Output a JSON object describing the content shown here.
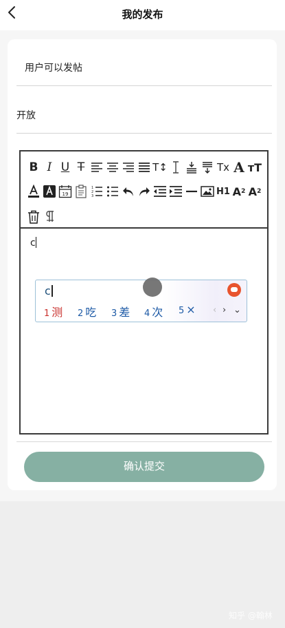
{
  "header": {
    "title": "我的发布",
    "back_icon": "chevron-left-icon"
  },
  "form": {
    "permission_label": "用户可以发帖",
    "visibility_value": "开放"
  },
  "editor": {
    "toolbar_row1": [
      "B",
      "I",
      "U",
      "S",
      "align-left",
      "align-center",
      "align-right",
      "align-justify",
      "font-size",
      "line-height",
      "indent-top",
      "indent-bottom",
      "clear-format",
      "A-big",
      "text-height"
    ],
    "toolbar_row2": [
      "text-color",
      "bg-color",
      "date",
      "clipboard",
      "ordered-list",
      "unordered-list",
      "undo",
      "redo",
      "outdent",
      "indent",
      "horizontal-rule",
      "image",
      "H1",
      "subscript",
      "superscript"
    ],
    "toolbar_row3": [
      "delete",
      "paragraph"
    ],
    "content": "c",
    "h1_label": "H1"
  },
  "ime": {
    "input": "c",
    "candidates": [
      {
        "num": "1",
        "text": "测"
      },
      {
        "num": "2",
        "text": "吃"
      },
      {
        "num": "3",
        "text": "差"
      },
      {
        "num": "4",
        "text": "次"
      },
      {
        "num": "5",
        "text": "×"
      }
    ],
    "nav_prev": "‹",
    "nav_next": "›",
    "expand": "⌄"
  },
  "submit": {
    "label": "确认提交"
  },
  "watermark": "知乎 @翰林",
  "colors": {
    "submit_bg": "#86b0a3",
    "ime_border": "#9cc0d8",
    "candidate_first": "#c9302c",
    "candidate": "#1d5aa6"
  }
}
